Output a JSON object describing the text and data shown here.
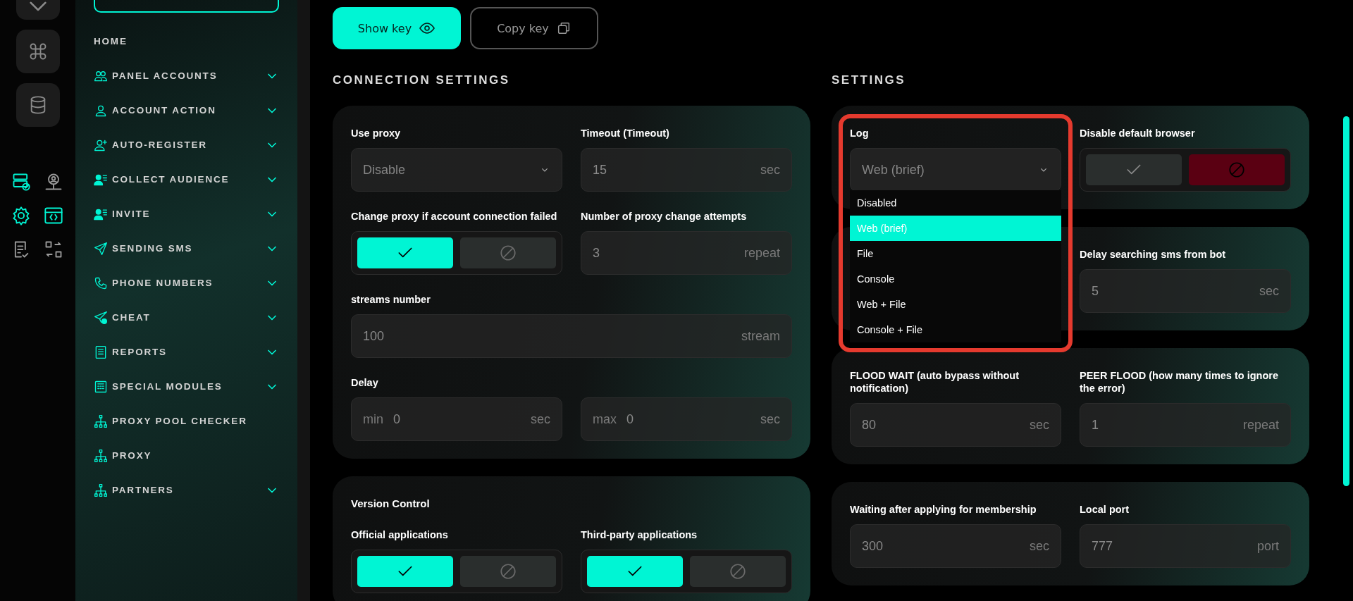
{
  "rail": {
    "shortcuts": [
      {
        "selected": true
      },
      {
        "selected": false
      },
      {
        "selected": true
      },
      {
        "selected": true
      },
      {
        "selected": false
      },
      {
        "selected": false
      }
    ]
  },
  "sidebar": {
    "items": [
      {
        "label": "HOME",
        "expandable": false
      },
      {
        "label": "PANEL ACCOUNTS",
        "expandable": true
      },
      {
        "label": "ACCOUNT ACTION",
        "expandable": true
      },
      {
        "label": "AUTO-REGISTER",
        "expandable": true
      },
      {
        "label": "COLLECT AUDIENCE",
        "expandable": true
      },
      {
        "label": "INVITE",
        "expandable": true
      },
      {
        "label": "SENDING SMS",
        "expandable": true
      },
      {
        "label": "PHONE NUMBERS",
        "expandable": true
      },
      {
        "label": "CHEAT",
        "expandable": true
      },
      {
        "label": "REPORTS",
        "expandable": true
      },
      {
        "label": "SPECIAL MODULES",
        "expandable": true
      },
      {
        "label": "PROXY POOL CHECKER",
        "expandable": false
      },
      {
        "label": "PROXY",
        "expandable": false
      },
      {
        "label": "PARTNERS",
        "expandable": true
      }
    ]
  },
  "key_buttons": [
    {
      "label": "Show key",
      "selected": true
    },
    {
      "label": "Copy key",
      "selected": false
    }
  ],
  "connection_settings": {
    "title": "CONNECTION SETTINGS",
    "cards": [
      {
        "fields": [
          {
            "kind": "select",
            "label": "Use proxy",
            "value": "Disable"
          },
          {
            "kind": "input",
            "label": "Timeout (Timeout)",
            "value": "15",
            "unit": "sec"
          },
          {
            "kind": "toggle",
            "label": "Change proxy if account connection failed",
            "on": true
          },
          {
            "kind": "input",
            "label": "Number of proxy change attempts",
            "value": "3",
            "unit": "repeat"
          },
          {
            "kind": "input",
            "label": "streams number",
            "value": "100",
            "unit": "stream",
            "wide": true
          },
          {
            "kind": "range",
            "label": "Delay",
            "parts": [
              {
                "prefix": "min",
                "value": "0",
                "unit": "sec"
              },
              {
                "prefix": "max",
                "value": "0",
                "unit": "sec"
              }
            ]
          }
        ]
      },
      {
        "fields": [
          {
            "kind": "heading",
            "label": "Version Control"
          },
          {
            "kind": "toggle",
            "label": "Official applications",
            "on": true
          },
          {
            "kind": "toggle",
            "label": "Third-party applications",
            "on": true
          }
        ]
      }
    ]
  },
  "settings": {
    "title": "SETTINGS",
    "cards": [
      {
        "fields": [
          {
            "kind": "select",
            "label": "Log",
            "value": "Web (brief)",
            "highlighted": true,
            "options": [
              {
                "label": "Disabled",
                "selected": false
              },
              {
                "label": "Web (brief)",
                "selected": true
              },
              {
                "label": "File",
                "selected": false
              },
              {
                "label": "Console",
                "selected": false
              },
              {
                "label": "Web + File",
                "selected": false
              },
              {
                "label": "Console + File",
                "selected": false
              }
            ]
          },
          {
            "kind": "toggle",
            "label": "Disable default browser",
            "on": false
          }
        ]
      },
      {
        "fields": [
          {
            "kind": "covered"
          },
          {
            "kind": "input",
            "label": "Delay searching sms from bot",
            "value": "5",
            "unit": "sec"
          }
        ]
      },
      {
        "fields": [
          {
            "kind": "input",
            "label": "FLOOD WAIT (auto bypass without notification)",
            "value": "80",
            "unit": "sec"
          },
          {
            "kind": "input",
            "label": "PEER FLOOD (how many times to ignore the error)",
            "value": "1",
            "unit": "repeat"
          }
        ]
      },
      {
        "fields": [
          {
            "kind": "input",
            "label": "Waiting after applying for membership",
            "value": "300",
            "unit": "sec"
          },
          {
            "kind": "input",
            "label": "Local port",
            "value": "777",
            "unit": "port"
          }
        ]
      }
    ]
  }
}
